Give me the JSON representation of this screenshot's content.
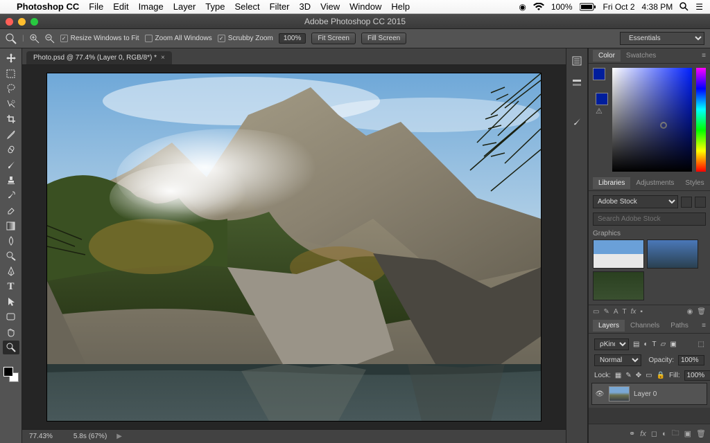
{
  "mac_menu": {
    "app": "Photoshop CC",
    "items": [
      "File",
      "Edit",
      "Image",
      "Layer",
      "Type",
      "Select",
      "Filter",
      "3D",
      "View",
      "Window",
      "Help"
    ],
    "battery": "100%",
    "day": "Fri Oct 2",
    "time": "4:38 PM"
  },
  "window_title": "Adobe Photoshop CC 2015",
  "options_bar": {
    "resize": "Resize Windows to Fit",
    "zoom_all": "Zoom All Windows",
    "scrubby": "Scrubby Zoom",
    "zoom_pct": "100%",
    "fit": "Fit Screen",
    "fill": "Fill Screen",
    "workspace": "Essentials"
  },
  "doc_tab": "Photo.psd @ 77.4% (Layer 0, RGB/8*) *",
  "status": {
    "zoom": "77.43%",
    "timing": "5.8s (67%)"
  },
  "panel_color": {
    "tab1": "Color",
    "tab2": "Swatches"
  },
  "panel_lib": {
    "tab1": "Libraries",
    "tab2": "Adjustments",
    "tab3": "Styles",
    "source": "Adobe Stock",
    "search_ph": "Search Adobe Stock",
    "section": "Graphics"
  },
  "panel_layers": {
    "tab1": "Layers",
    "tab2": "Channels",
    "tab3": "Paths",
    "kind": "Kind",
    "blend": "Normal",
    "opacity_lbl": "Opacity:",
    "opacity_val": "100%",
    "lock_lbl": "Lock:",
    "fill_lbl": "Fill:",
    "fill_val": "100%",
    "layer0": "Layer 0"
  }
}
